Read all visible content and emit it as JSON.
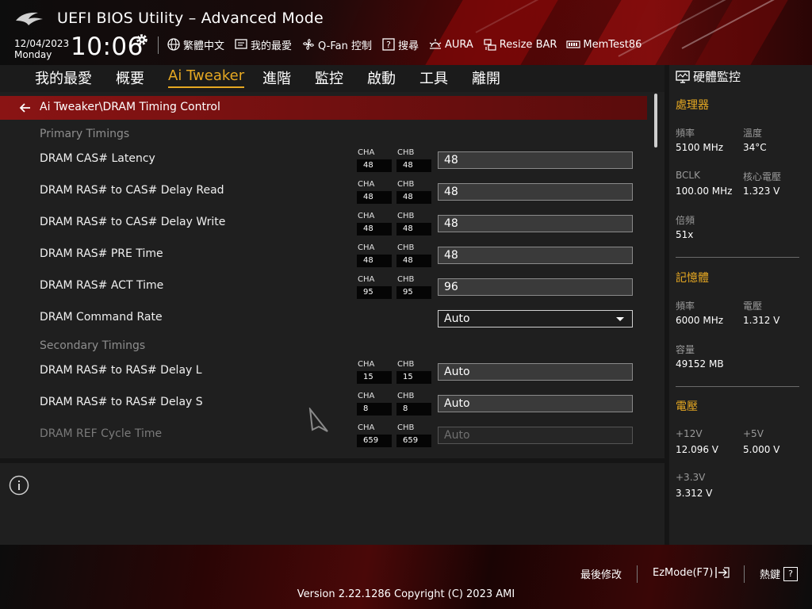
{
  "header": {
    "title": "UEFI BIOS Utility – Advanced Mode",
    "date": "12/04/2023",
    "weekday": "Monday",
    "time": "10:06",
    "toolbar": [
      {
        "icon": "globe-icon",
        "label": "繁體中文"
      },
      {
        "icon": "favorites-icon",
        "label": "我的最愛"
      },
      {
        "icon": "fan-icon",
        "label": "Q-Fan 控制"
      },
      {
        "icon": "help-search-icon",
        "label": "搜尋"
      },
      {
        "icon": "aura-icon",
        "label": "AURA"
      },
      {
        "icon": "resize-bar-icon",
        "label": "Resize BAR"
      },
      {
        "icon": "memtest-icon",
        "label": "MemTest86"
      }
    ]
  },
  "nav": {
    "tabs": [
      {
        "label": "我的最愛",
        "active": false
      },
      {
        "label": "概要",
        "active": false
      },
      {
        "label": "Ai Tweaker",
        "active": true
      },
      {
        "label": "進階",
        "active": false
      },
      {
        "label": "監控",
        "active": false
      },
      {
        "label": "啟動",
        "active": false
      },
      {
        "label": "工具",
        "active": false
      },
      {
        "label": "離開",
        "active": false
      }
    ]
  },
  "main": {
    "breadcrumb": "Ai Tweaker\\DRAM Timing Control",
    "sections": {
      "primary": "Primary Timings",
      "secondary": "Secondary Timings"
    },
    "channel_labels": {
      "a": "CHA",
      "b": "CHB"
    },
    "rows": [
      {
        "label": "DRAM CAS# Latency",
        "cha": "48",
        "chb": "48",
        "value": "48",
        "type": "input",
        "enabled": true
      },
      {
        "label": "DRAM RAS# to CAS# Delay Read",
        "cha": "48",
        "chb": "48",
        "value": "48",
        "type": "input",
        "enabled": true
      },
      {
        "label": "DRAM RAS# to CAS# Delay Write",
        "cha": "48",
        "chb": "48",
        "value": "48",
        "type": "input",
        "enabled": true
      },
      {
        "label": "DRAM RAS# PRE Time",
        "cha": "48",
        "chb": "48",
        "value": "48",
        "type": "input",
        "enabled": true
      },
      {
        "label": "DRAM RAS# ACT Time",
        "cha": "95",
        "chb": "95",
        "value": "96",
        "type": "input",
        "enabled": true
      },
      {
        "label": "DRAM Command Rate",
        "cha": "",
        "chb": "",
        "value": "Auto",
        "type": "select",
        "enabled": true
      },
      {
        "label": "DRAM RAS# to RAS# Delay L",
        "cha": "15",
        "chb": "15",
        "value": "Auto",
        "type": "input",
        "enabled": true
      },
      {
        "label": "DRAM RAS# to RAS# Delay S",
        "cha": "8",
        "chb": "8",
        "value": "Auto",
        "type": "input",
        "enabled": true
      },
      {
        "label": "DRAM REF Cycle Time",
        "cha": "659",
        "chb": "659",
        "value": "Auto",
        "type": "input",
        "enabled": false
      }
    ]
  },
  "monitor": {
    "title": "硬體監控",
    "cpu": {
      "heading": "處理器",
      "freq_label": "頻率",
      "freq": "5100 MHz",
      "temp_label": "溫度",
      "temp": "34°C",
      "bclk_label": "BCLK",
      "bclk": "100.00 MHz",
      "vcore_label": "核心電壓",
      "vcore": "1.323 V",
      "ratio_label": "倍頻",
      "ratio": "51x"
    },
    "memory": {
      "heading": "記憶體",
      "freq_label": "頻率",
      "freq": "6000 MHz",
      "volt_label": "電壓",
      "volt": "1.312 V",
      "cap_label": "容量",
      "cap": "49152 MB"
    },
    "voltage": {
      "heading": "電壓",
      "v12_label": "+12V",
      "v12": "12.096 V",
      "v5_label": "+5V",
      "v5": "5.000 V",
      "v33_label": "+3.3V",
      "v33": "3.312 V"
    }
  },
  "footer": {
    "last_modified": "最後修改",
    "ezmode": "EzMode(F7)",
    "hotkeys": "熱鍵",
    "hotkey_symbol": "?",
    "version": "Version 2.22.1286 Copyright (C) 2023 AMI"
  },
  "colors": {
    "accent": "#e6a822",
    "breadcrumb_bg": "#8a1414",
    "panel_bg": "#1f1f1f"
  }
}
